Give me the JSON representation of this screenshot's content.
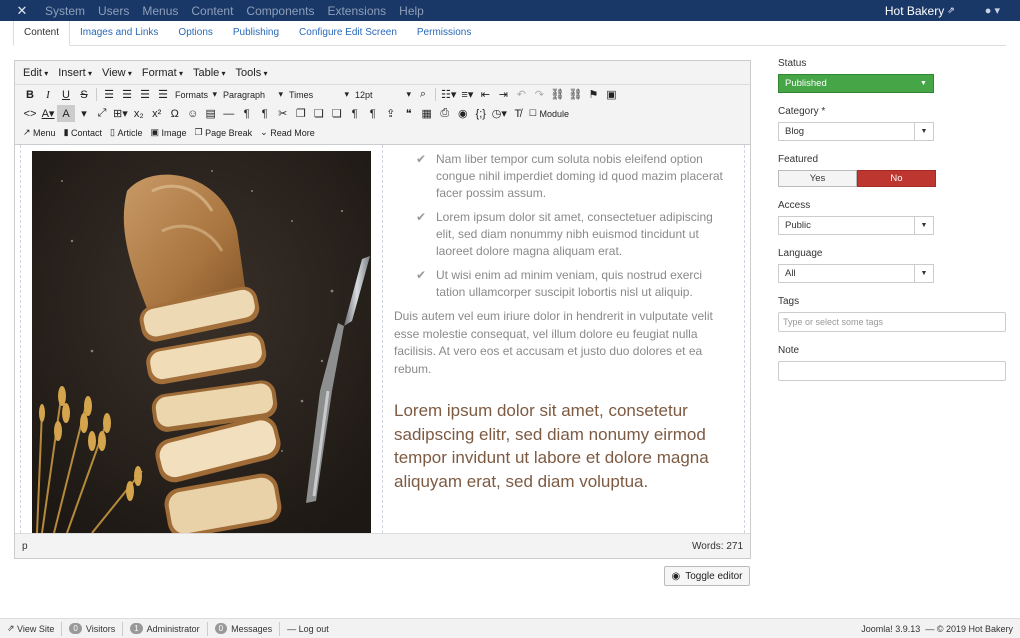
{
  "topbar": {
    "menu": [
      "System",
      "Users",
      "Menus",
      "Content",
      "Components",
      "Extensions",
      "Help"
    ],
    "site_name": "Hot Bakery",
    "user_icon": "user-icon"
  },
  "tabs": [
    "Content",
    "Images and Links",
    "Options",
    "Publishing",
    "Configure Edit Screen",
    "Permissions"
  ],
  "editor": {
    "menubar": [
      "Edit",
      "Insert",
      "View",
      "Format",
      "Table",
      "Tools"
    ],
    "formats_label": "Formats",
    "block_format": "Paragraph",
    "font_family": "Times",
    "font_size": "12pt",
    "module_label": "Module",
    "buttons_row3": [
      "Menu",
      "Contact",
      "Article",
      "Image",
      "Page Break",
      "Read More"
    ],
    "checklist": [
      "Nam liber tempor cum soluta nobis eleifend option congue nihil imperdiet doming id quod mazim placerat facer possim assum.",
      "Lorem ipsum dolor sit amet, consectetuer adipiscing elit, sed diam nonummy nibh euismod tincidunt ut laoreet dolore magna aliquam erat.",
      "Ut wisi enim ad minim veniam, quis nostrud exerci tation ullamcorper suscipit lobortis nisl ut aliquip."
    ],
    "paragraph": "Duis autem vel eum iriure dolor in hendrerit in vulputate velit esse molestie consequat, vel illum dolore eu feugiat nulla facilisis. At vero eos et accusam et justo duo dolores et ea rebum.",
    "lead": "Lorem ipsum dolor sit amet, consetetur sadipscing elitr, sed diam nonumy eirmod tempor invidunt ut labore et dolore magna aliquyam erat, sed diam voluptua.",
    "path": "p",
    "word_count": "Words: 271"
  },
  "toggle_label": "Toggle editor",
  "sidebar": {
    "status_label": "Status",
    "status_value": "Published",
    "category_label": "Category *",
    "category_value": "Blog",
    "featured_label": "Featured",
    "featured_yes": "Yes",
    "featured_no": "No",
    "access_label": "Access",
    "access_value": "Public",
    "language_label": "Language",
    "language_value": "All",
    "tags_label": "Tags",
    "tags_placeholder": "Type or select some tags",
    "note_label": "Note",
    "note_value": ""
  },
  "footer": {
    "view_site": "View Site",
    "visitors_count": "0",
    "visitors_label": "Visitors",
    "admin_count": "1",
    "admin_label": "Administrator",
    "messages_count": "0",
    "messages_label": "Messages",
    "logout": "Log out",
    "version": "Joomla! 3.9.13",
    "copyright": "— © 2019 Hot Bakery"
  },
  "colors": {
    "topbar": "#1a3867",
    "published": "#46a546",
    "no": "#bd362f",
    "link": "#2a69b8"
  }
}
